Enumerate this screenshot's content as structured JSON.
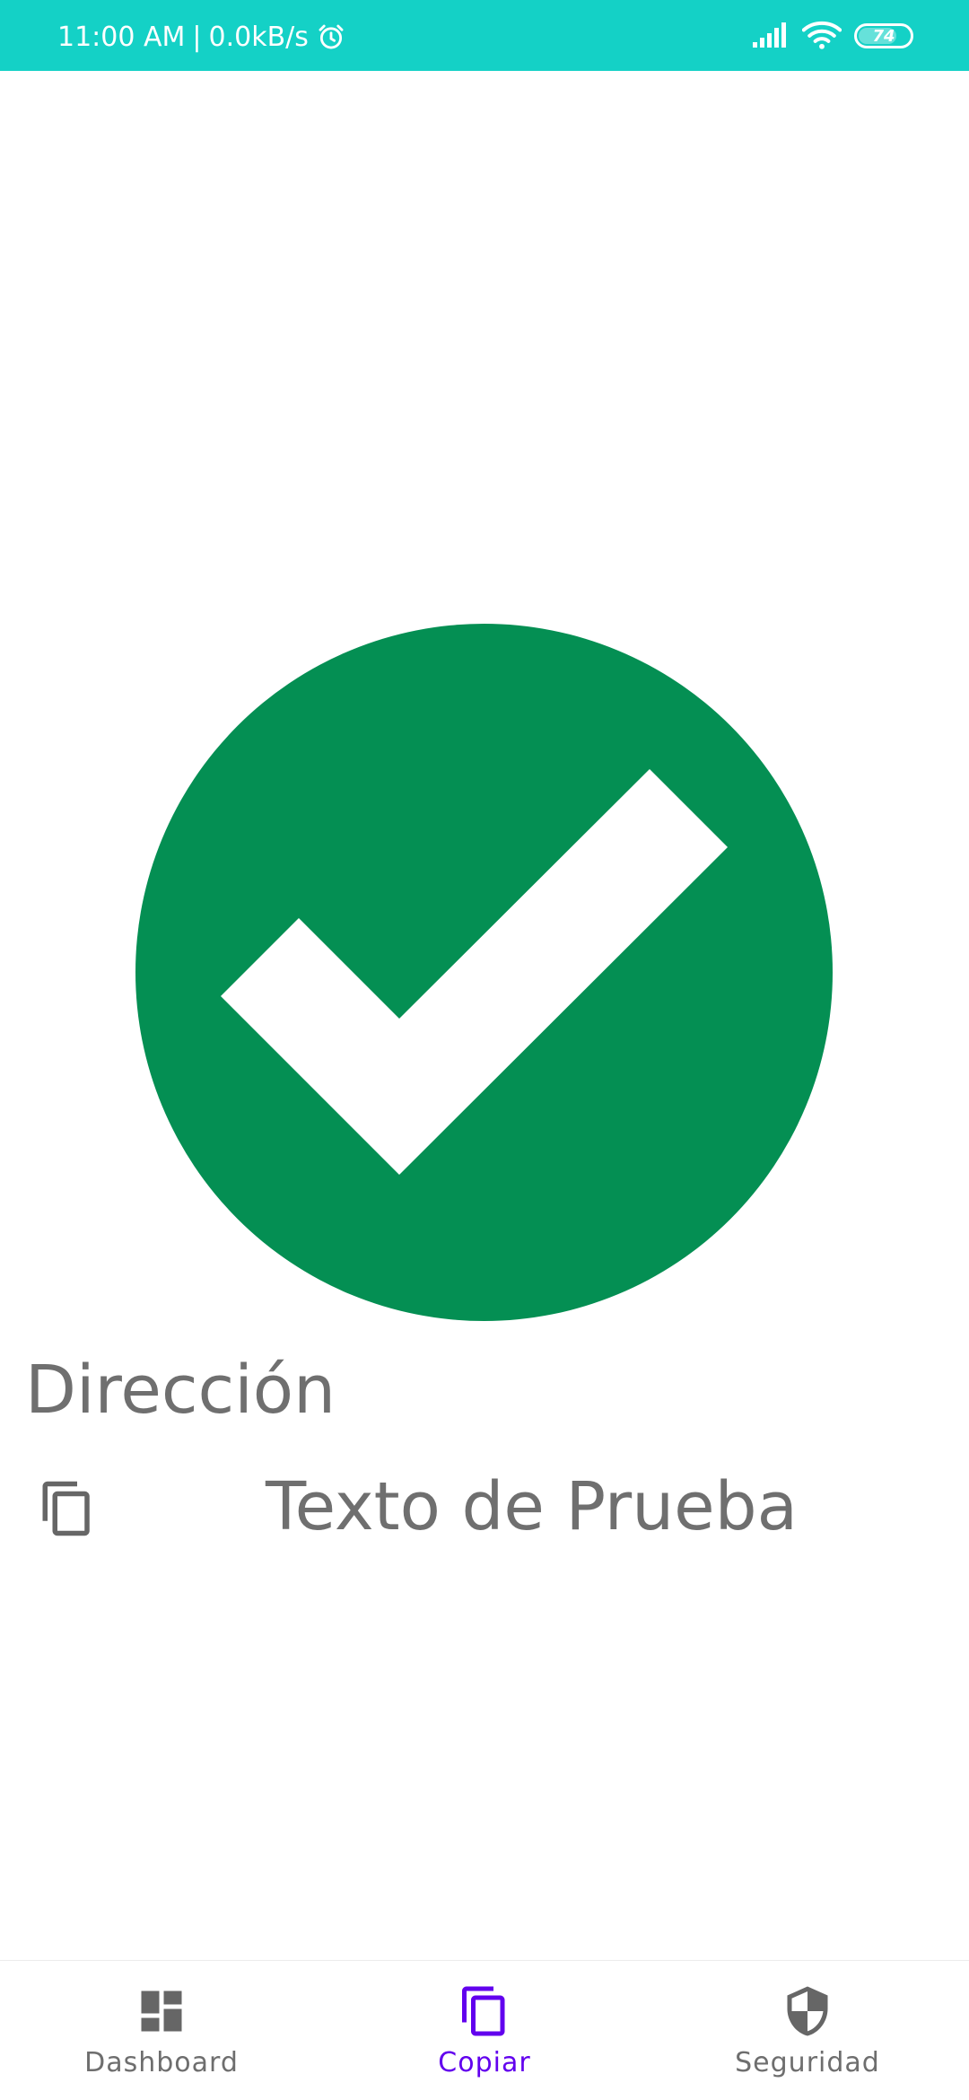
{
  "status_bar": {
    "time": "11:00 AM",
    "separator": "|",
    "network_speed": "0.0kB/s",
    "battery_level": "74",
    "icons": [
      "alarm-icon",
      "signal-icon",
      "wifi-icon",
      "battery-icon"
    ]
  },
  "main": {
    "status_icon": "check-circle-icon",
    "field_label": "Dirección",
    "copy_icon": "copy-icon",
    "field_value": "Texto de Prueba"
  },
  "bottom_nav": {
    "items": [
      {
        "label": "Dashboard",
        "icon": "dashboard-icon",
        "active": false
      },
      {
        "label": "Copiar",
        "icon": "copy-icon",
        "active": true
      },
      {
        "label": "Seguridad",
        "icon": "shield-icon",
        "active": false
      }
    ]
  },
  "colors": {
    "status_bar": "#14d1c6",
    "success_green": "#048f53",
    "active_accent": "#6200ee",
    "text_gray": "#6f6f6f",
    "icon_gray": "#666666"
  }
}
